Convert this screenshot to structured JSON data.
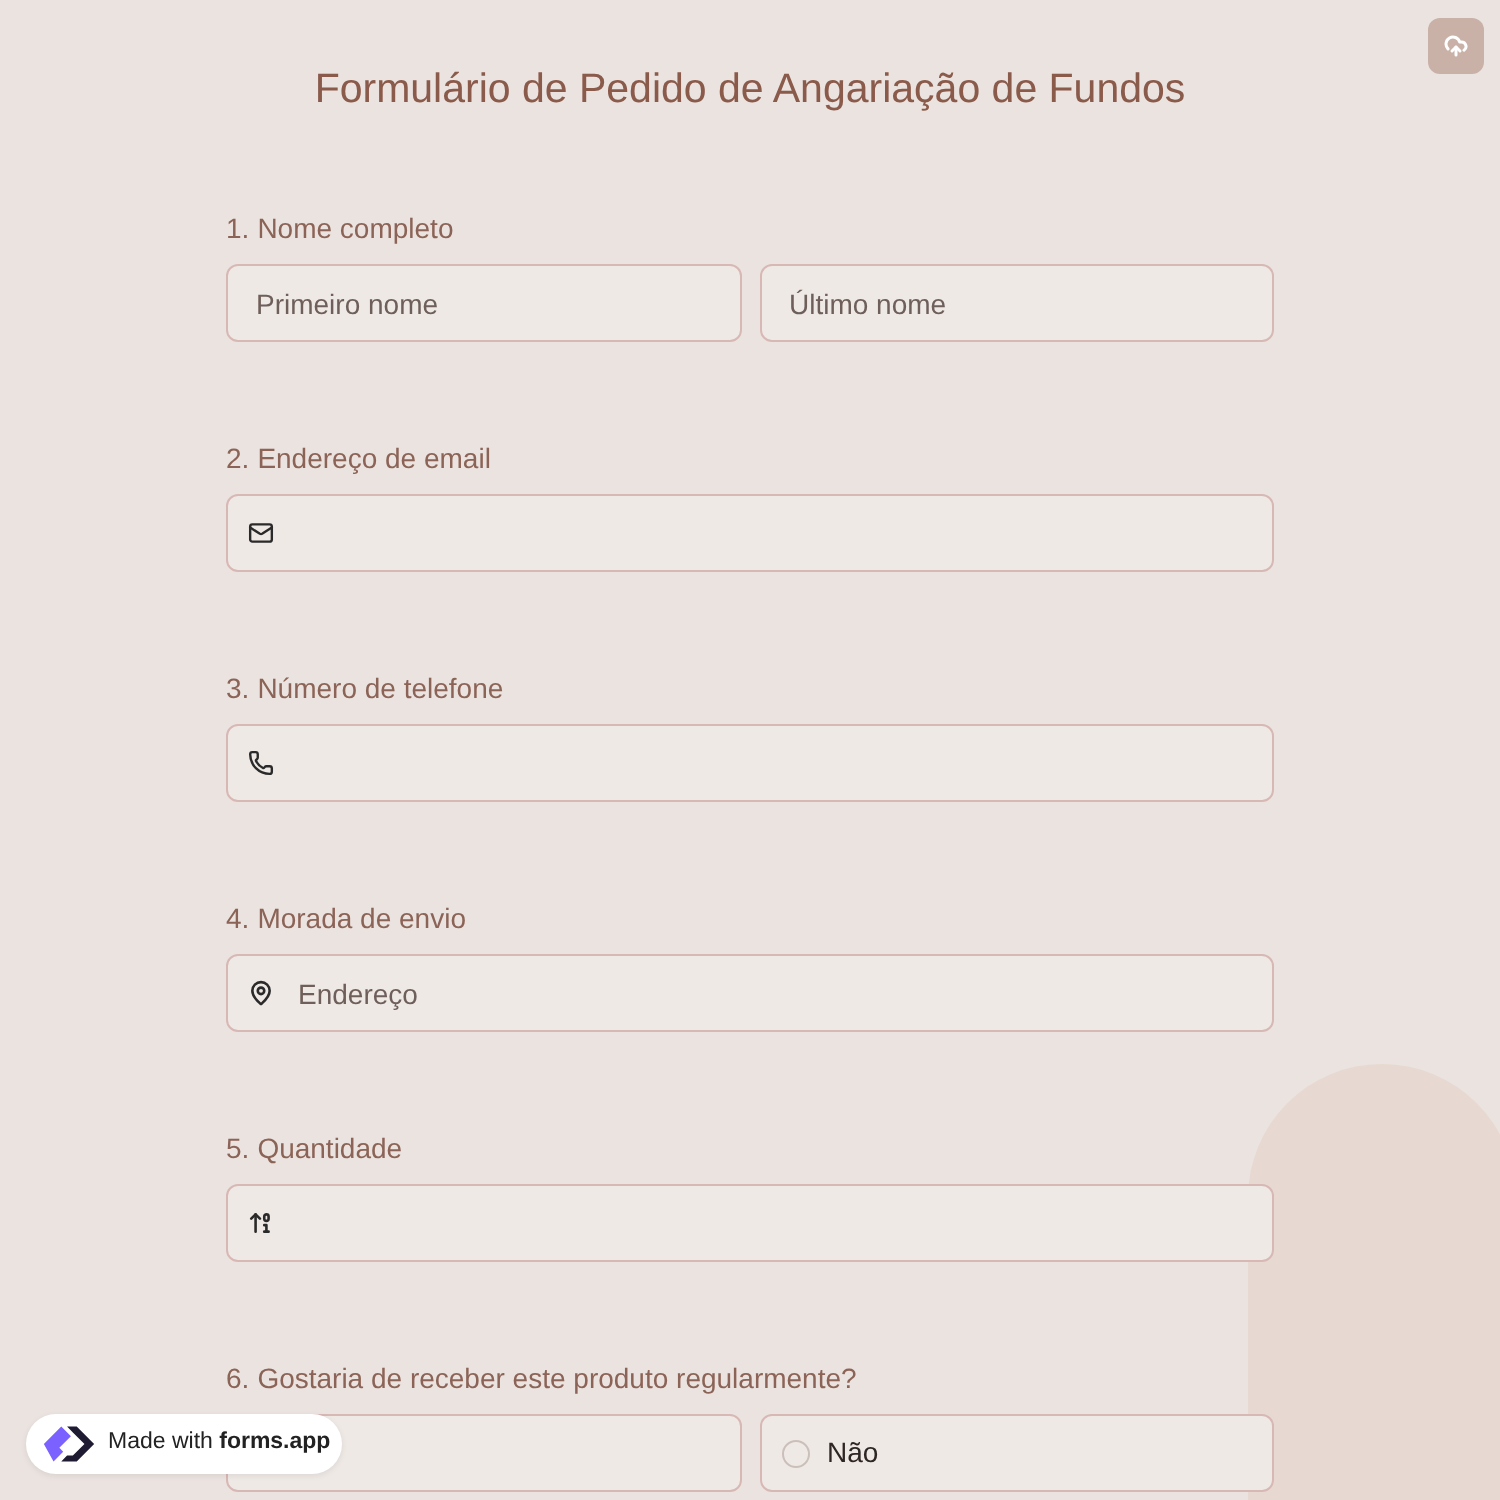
{
  "title": "Formulário de Pedido de Angariação de Fundos",
  "questions": [
    {
      "number": "1.",
      "label": "Nome completo",
      "kind": "name",
      "fields": [
        {
          "placeholder": "Primeiro nome"
        },
        {
          "placeholder": "Último nome"
        }
      ]
    },
    {
      "number": "2.",
      "label": "Endereço de email",
      "kind": "email"
    },
    {
      "number": "3.",
      "label": "Número de telefone",
      "kind": "phone"
    },
    {
      "number": "4.",
      "label": "Morada de envio",
      "kind": "address",
      "placeholder": "Endereço"
    },
    {
      "number": "5.",
      "label": "Quantidade",
      "kind": "number"
    },
    {
      "number": "6.",
      "label": "Gostaria de receber este produto regularmente?",
      "kind": "choice",
      "options": [
        {
          "kind": "covered"
        },
        {
          "kind": "radio",
          "label": "Não",
          "selected": false
        }
      ]
    }
  ],
  "badge": {
    "text": "Made with **forms.app**"
  }
}
